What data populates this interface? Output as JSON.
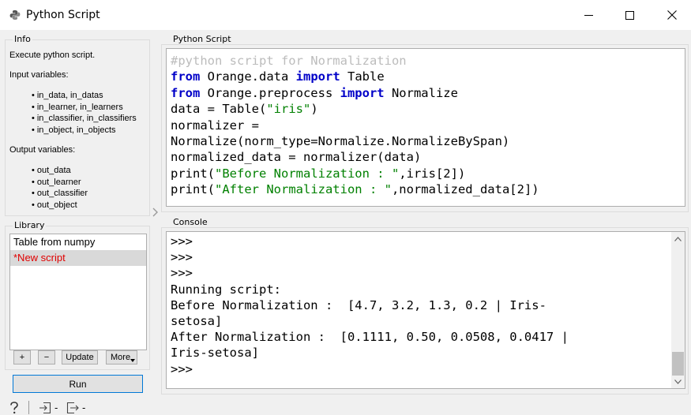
{
  "window": {
    "title": "Python Script"
  },
  "info": {
    "group_title": "Info",
    "description": "Execute python script.",
    "input_heading": "Input variables:",
    "input_vars": [
      "in_data, in_datas",
      "in_learner, in_learners",
      "in_classifier, in_classifiers",
      "in_object, in_objects"
    ],
    "output_heading": "Output variables:",
    "output_vars": [
      "out_data",
      "out_learner",
      "out_classifier",
      "out_object"
    ]
  },
  "library": {
    "group_title": "Library",
    "items": [
      {
        "label": "Table from numpy",
        "selected": false
      },
      {
        "label": "*New script",
        "selected": true
      }
    ],
    "buttons": {
      "add": "+",
      "remove": "−",
      "update": "Update",
      "more": "More"
    }
  },
  "run_button": "Run",
  "script": {
    "group_title": "Python Script",
    "lines": [
      [
        {
          "t": "#python script for Normalization",
          "c": "cm"
        }
      ],
      [
        {
          "t": "from",
          "c": "kw"
        },
        {
          "t": " Orange.data ",
          "c": ""
        },
        {
          "t": "import",
          "c": "kw"
        },
        {
          "t": " Table",
          "c": ""
        }
      ],
      [
        {
          "t": "from",
          "c": "kw"
        },
        {
          "t": " Orange.preprocess ",
          "c": ""
        },
        {
          "t": "import",
          "c": "kw"
        },
        {
          "t": " Normalize",
          "c": ""
        }
      ],
      [
        {
          "t": "data = Table(",
          "c": ""
        },
        {
          "t": "\"iris\"",
          "c": "st"
        },
        {
          "t": ")",
          "c": ""
        }
      ],
      [
        {
          "t": "normalizer =",
          "c": ""
        }
      ],
      [
        {
          "t": "Normalize(norm_type=Normalize.NormalizeBySpan)",
          "c": ""
        }
      ],
      [
        {
          "t": "normalized_data = normalizer(data)",
          "c": ""
        }
      ],
      [
        {
          "t": "print(",
          "c": ""
        },
        {
          "t": "\"Before Normalization : \"",
          "c": "st"
        },
        {
          "t": ",iris[2])",
          "c": ""
        }
      ],
      [
        {
          "t": "print(",
          "c": ""
        },
        {
          "t": "\"After Normalization : \"",
          "c": "st"
        },
        {
          "t": ",normalized_data[2])",
          "c": ""
        }
      ]
    ]
  },
  "console": {
    "group_title": "Console",
    "lines": [
      ">>>",
      ">>>",
      ">>>",
      "Running script:",
      "Before Normalization :  [4.7, 3.2, 1.3, 0.2 | Iris-",
      "setosa]",
      "After Normalization :  [0.1111, 0.50, 0.0508, 0.0417 |",
      "Iris-setosa]",
      ">>>"
    ]
  },
  "statusbar": {
    "input_count": "-",
    "output_count": "-"
  }
}
